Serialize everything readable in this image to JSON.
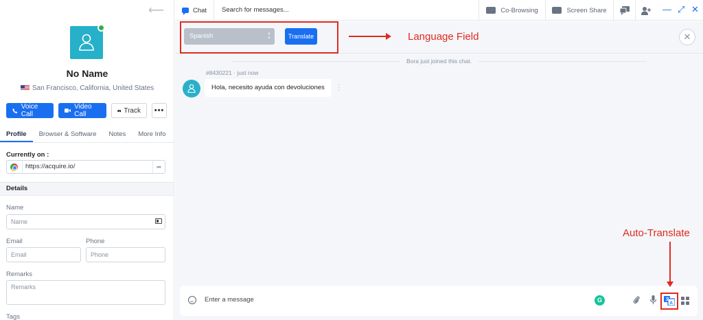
{
  "visitor": {
    "name": "No Name",
    "location": "San Francisco, California, United States"
  },
  "actions": {
    "voice_call": "Voice Call",
    "video_call": "Video Call",
    "track": "Track",
    "more": "•••"
  },
  "tabs": [
    "Profile",
    "Browser & Software",
    "Notes",
    "More Info"
  ],
  "currently_on": {
    "label": "Currently on :",
    "url": "https://acquire.io/"
  },
  "details": {
    "heading": "Details",
    "name_label": "Name",
    "name_placeholder": "Name",
    "email_label": "Email",
    "email_placeholder": "Email",
    "phone_label": "Phone",
    "phone_placeholder": "Phone",
    "remarks_label": "Remarks",
    "remarks_placeholder": "Remarks",
    "tags_label": "Tags"
  },
  "topbar": {
    "chat_tab": "Chat",
    "search_placeholder": "Search for messages...",
    "co_browsing": "Co-Browsing",
    "screen_share": "Screen Share"
  },
  "translate_bar": {
    "language": "Spanish",
    "translate_button": "Translate"
  },
  "chat": {
    "system_message": "Bora just joined this chat.",
    "message_id": "#8430221",
    "message_time": "just now",
    "message_text": "Hola, necesito ayuda con devoluciones"
  },
  "composer": {
    "placeholder": "Enter a message"
  },
  "annotations": {
    "language_field": "Language Field",
    "auto_translate": "Auto-Translate",
    "color": "#e02a1f"
  },
  "colors": {
    "accent": "#1a6ff0",
    "avatar": "#26b0c9",
    "online": "#2bb24c"
  }
}
